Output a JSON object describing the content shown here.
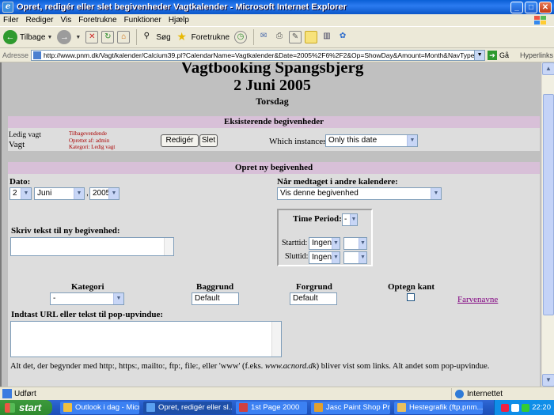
{
  "window": {
    "title": "Opret, redigér eller slet begivenheder Vagtkalender - Microsoft Internet Explorer",
    "app_icon": "ie-icon",
    "minimize": "_",
    "maximize": "□",
    "close": "✕"
  },
  "menu": [
    "Filer",
    "Rediger",
    "Vis",
    "Foretrukne",
    "Funktioner",
    "Hjælp"
  ],
  "toolbar": {
    "back": "Tilbage",
    "search": "Søg",
    "favorites": "Foretrukne"
  },
  "address": {
    "label": "Adresse",
    "url": "http://www.pnm.dk/Vagt/kalender/Calcium39.pl?CalendarName=Vagtkalender&Date=2005%2F6%2F2&Op=ShowDay&Amount=Month&NavType=Absolute&Type=Bl",
    "go": "Gå",
    "links": "Hyperlinks"
  },
  "page": {
    "heading": "Vagtbooking Spangsbjerg",
    "date": "2 Juni 2005",
    "weekday": "Torsdag"
  },
  "existing": {
    "header": "Eksisterende begivenheder",
    "event_label": "Ledig vagt",
    "event_title": "Vagt",
    "event_info": [
      "Tilbagevendende",
      "Oprettet af: admin",
      "Kategori: Ledig vagt"
    ],
    "edit_button": "Redigér",
    "delete_button": "Slet",
    "instances_label": "Which instances:",
    "instances_value": "Only this date"
  },
  "create": {
    "header": "Opret ny begivenhed",
    "date_label": "Dato:",
    "day_value": "2",
    "month_value": "Juni",
    "year_value": "2005",
    "comma": ",",
    "included_label": "Når medtaget i andre kalendere:",
    "included_value": "Vis denne begivenhed",
    "text_label": "Skriv tekst til ny begivenhed:",
    "time_period_label": "Time Period:",
    "time_period_value": "-",
    "start_label": "Starttid:",
    "start_value": "Ingen",
    "end_label": "Sluttid:",
    "end_value": "Ingen",
    "category_label": "Kategori",
    "category_value": "-",
    "background_label": "Baggrund",
    "background_value": "Default",
    "foreground_label": "Forgrund",
    "foreground_value": "Default",
    "border_label": "Optegn kant",
    "color_names_link": "Farvenavne",
    "url_label": "Indtast URL eller tekst til pop-upvindue:",
    "hint_prefix": "Alt det, der begynder med http:, https:, mailto:, ftp:, file:, eller 'www' (f.eks. ",
    "hint_example": "www.acnord.dk",
    "hint_suffix": ") bliver vist som links. Alt andet som pop-upvindue."
  },
  "status": {
    "text": "Udført",
    "zone": "Internettet"
  },
  "taskbar": {
    "start": "start",
    "tasks": [
      "Outlook i dag - Micros...",
      "Opret, redigér eller sl...",
      "1st Page 2000",
      "Jasc Paint Shop Pro",
      "Hestegrafik (ftp.pnm...."
    ],
    "clock": "22:20"
  }
}
